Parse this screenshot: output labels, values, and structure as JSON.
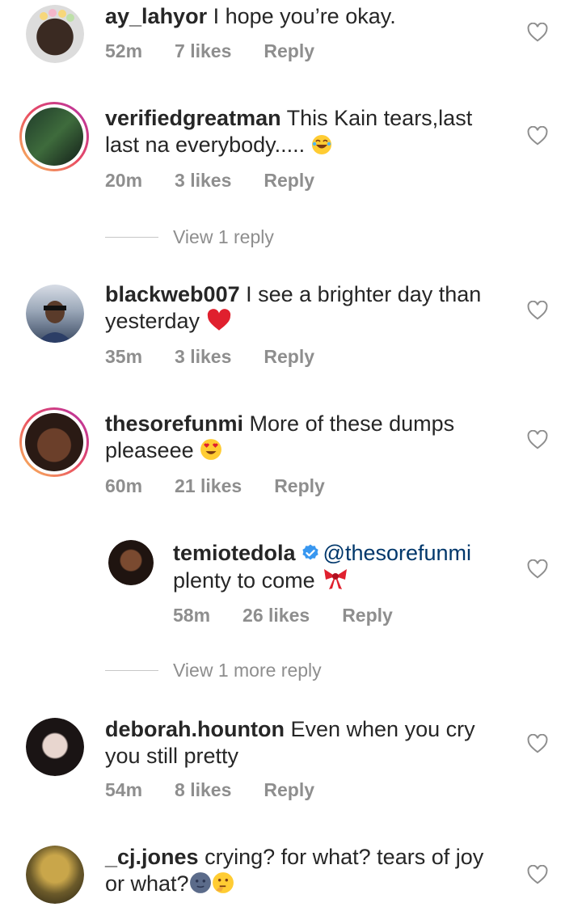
{
  "comments": [
    {
      "username": "ay_lahyor",
      "text": "I hope you’re okay.",
      "time": "52m",
      "likes": "7 likes",
      "reply": "Reply"
    },
    {
      "username": "verifiedgreatman",
      "text": "This Kain tears,last last na everybody.....",
      "time": "20m",
      "likes": "3 likes",
      "reply": "Reply",
      "view_replies": "View 1 reply"
    },
    {
      "username": "blackweb007",
      "text": "I see a brighter day than yesterday",
      "time": "35m",
      "likes": "3 likes",
      "reply": "Reply"
    },
    {
      "username": "thesorefunmi",
      "text": "More of these dumps pleaseee",
      "time": "60m",
      "likes": "21 likes",
      "reply": "Reply"
    },
    {
      "username": "temiotedola",
      "mention": "@thesorefunmi",
      "text": "plenty to come",
      "time": "58m",
      "likes": "26 likes",
      "reply": "Reply",
      "view_replies": "View 1 more reply"
    },
    {
      "username": "deborah.hounton",
      "text": "Even when you cry you still pretty",
      "time": "54m",
      "likes": "8 likes",
      "reply": "Reply"
    },
    {
      "username": "_cj.jones",
      "text": "crying? for what? tears of joy or what?"
    }
  ],
  "icons": {
    "like": "heart-outline-icon",
    "verified": "verified-badge-icon"
  },
  "colors": {
    "verified": "#3897f0",
    "mention": "#00376b",
    "meta": "#8e8e8e"
  }
}
